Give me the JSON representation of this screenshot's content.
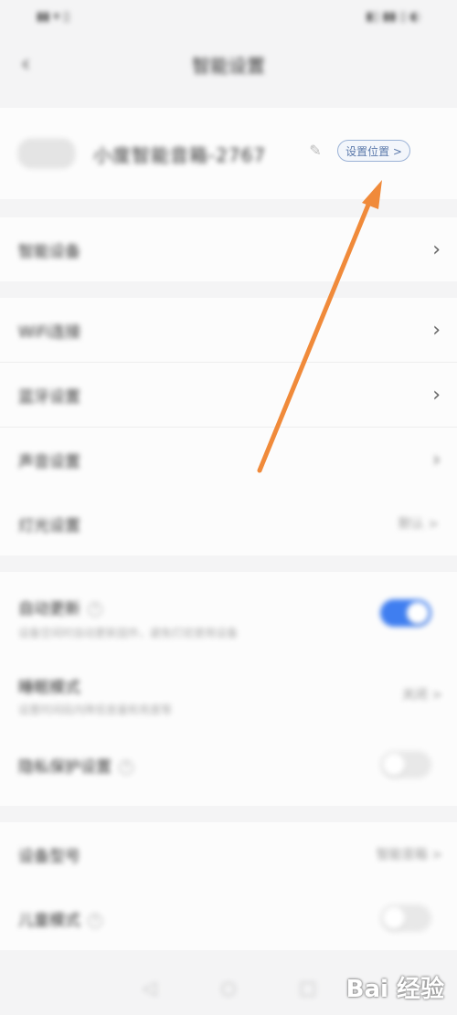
{
  "status_bar": {
    "left": "▮▮ ▾ ▯",
    "right": "▮▯ ▮▮ ▯ ◐"
  },
  "header": {
    "title": "智能设置",
    "back_icon": "back-arrow-icon"
  },
  "device": {
    "name": "小度智能音箱-2767",
    "set_location_label": "设置位置 >"
  },
  "section1": {
    "row1": "智能设备"
  },
  "section2": {
    "rows": [
      {
        "label": "WiFi连接"
      },
      {
        "label": "蓝牙设置"
      },
      {
        "label": "声音设置"
      },
      {
        "label": "灯光设置",
        "value": "默认 >"
      }
    ]
  },
  "section3": {
    "auto_update": {
      "label": "自动更新",
      "sub": "设备空闲时自动更新固件，避免打扰使用设备",
      "on": true
    },
    "sleep_mode": {
      "label": "睡眠模式",
      "sub": "设置时间段内降低音量和亮度等",
      "value": "关闭 >"
    },
    "personal": {
      "label": "隐私保护设置",
      "on": false
    }
  },
  "section4": {
    "device_model": {
      "label": "设备型号",
      "value": "智能音箱 >"
    },
    "child_mode": {
      "label": "儿童模式",
      "on": false
    }
  },
  "bottom_nav": {
    "icons": [
      "back-nav-icon",
      "home-nav-icon",
      "recent-apps-icon"
    ]
  },
  "watermark": {
    "text": "Bai 经验"
  },
  "colors": {
    "toggle_on": "#3f7ef0",
    "arrow": "#f08a3a",
    "accent_blue": "#5a78aa"
  }
}
